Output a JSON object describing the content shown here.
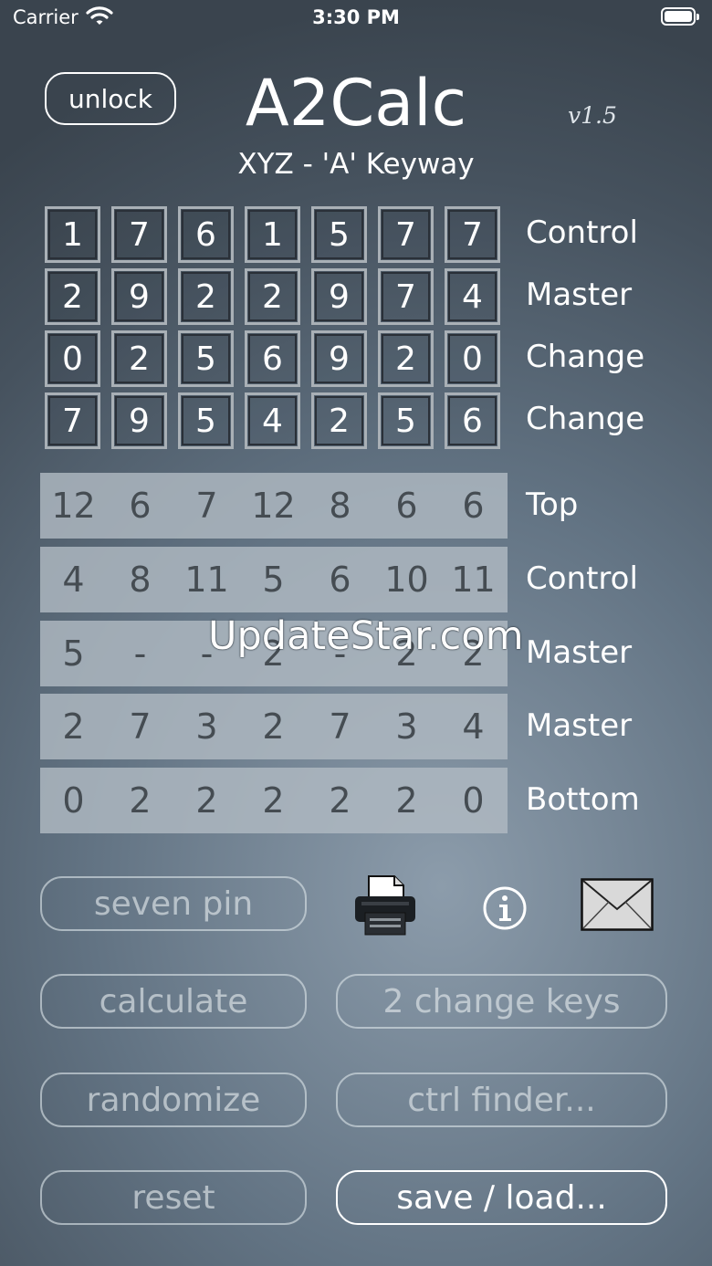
{
  "status_bar": {
    "carrier": "Carrier",
    "time": "3:30 PM"
  },
  "header": {
    "unlock_label": "unlock",
    "title": "A2Calc",
    "version": "v1.5",
    "subtitle": "XYZ - 'A' Keyway"
  },
  "pin_grid": [
    {
      "label": "Control",
      "values": [
        "1",
        "7",
        "6",
        "1",
        "5",
        "7",
        "7"
      ]
    },
    {
      "label": "Master",
      "values": [
        "2",
        "9",
        "2",
        "2",
        "9",
        "7",
        "4"
      ]
    },
    {
      "label": "Change",
      "values": [
        "0",
        "2",
        "5",
        "6",
        "9",
        "2",
        "0"
      ]
    },
    {
      "label": "Change",
      "values": [
        "7",
        "9",
        "5",
        "4",
        "2",
        "5",
        "6"
      ]
    }
  ],
  "results": [
    {
      "label": "Top",
      "values": [
        "12",
        "6",
        "7",
        "12",
        "8",
        "6",
        "6"
      ]
    },
    {
      "label": "Control",
      "values": [
        "4",
        "8",
        "11",
        "5",
        "6",
        "10",
        "11"
      ]
    },
    {
      "label": "Master",
      "values": [
        "5",
        "-",
        "-",
        "2",
        "-",
        "2",
        "2"
      ]
    },
    {
      "label": "Master",
      "values": [
        "2",
        "7",
        "3",
        "2",
        "7",
        "3",
        "4"
      ]
    },
    {
      "label": "Bottom",
      "values": [
        "0",
        "2",
        "2",
        "2",
        "2",
        "2",
        "0"
      ]
    }
  ],
  "watermark": "UpdateStar.com",
  "buttons": {
    "seven_pin": "seven pin",
    "calculate": "calculate",
    "change_keys": "2 change keys",
    "randomize": "randomize",
    "ctrl_finder": "ctrl finder...",
    "reset": "reset",
    "save_load": "save / load..."
  },
  "icons": {
    "print": "printer-icon",
    "info": "info-icon",
    "mail": "mail-icon"
  }
}
